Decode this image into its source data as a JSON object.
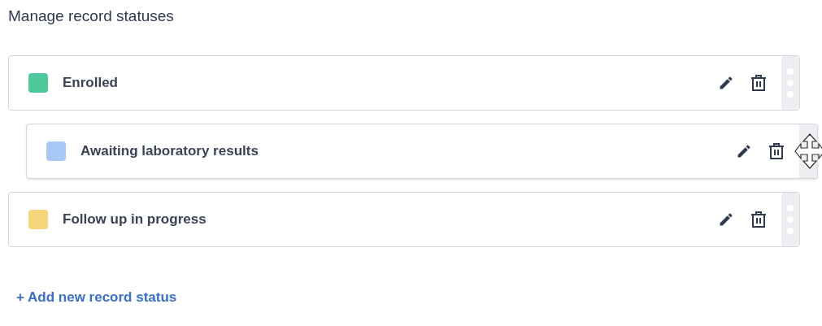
{
  "title": "Manage record statuses",
  "statuses": [
    {
      "label": "Enrolled",
      "color": "#4fc99b",
      "dragging": false
    },
    {
      "label": "Awaiting laboratory results",
      "color": "#a8c9f8",
      "dragging": true
    },
    {
      "label": "Follow up in progress",
      "color": "#f6d57a",
      "dragging": false
    }
  ],
  "add_link": "+ Add new record status"
}
